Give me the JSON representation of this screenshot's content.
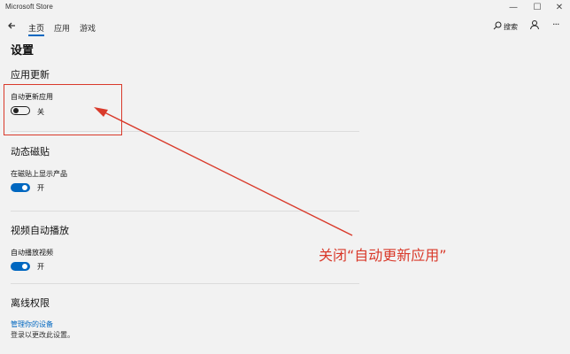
{
  "window": {
    "title": "Microsoft Store",
    "minimize": "—",
    "maximize": "☐",
    "close": "✕"
  },
  "nav": {
    "tabs": [
      {
        "label": "主页",
        "active": true
      },
      {
        "label": "应用",
        "active": false
      },
      {
        "label": "游戏",
        "active": false
      }
    ],
    "search_label": "搜索",
    "more": "···"
  },
  "page": {
    "title": "设置",
    "sections": [
      {
        "heading": "应用更新",
        "setting_label": "自动更新应用",
        "toggle_on": false,
        "state_text": "关"
      },
      {
        "heading": "动态磁贴",
        "setting_label": "在磁贴上显示产品",
        "toggle_on": true,
        "state_text": "开"
      },
      {
        "heading": "视频自动播放",
        "setting_label": "自动播放视频",
        "toggle_on": true,
        "state_text": "开"
      },
      {
        "heading": "离线权限",
        "link_text": "管理你的设备",
        "description": "登录以更改此设置。"
      }
    ]
  },
  "annotation": {
    "text": "关闭“自动更新应用”",
    "color": "#d93a2b"
  },
  "colors": {
    "accent": "#0067c0",
    "background": "#f2f2f2"
  }
}
